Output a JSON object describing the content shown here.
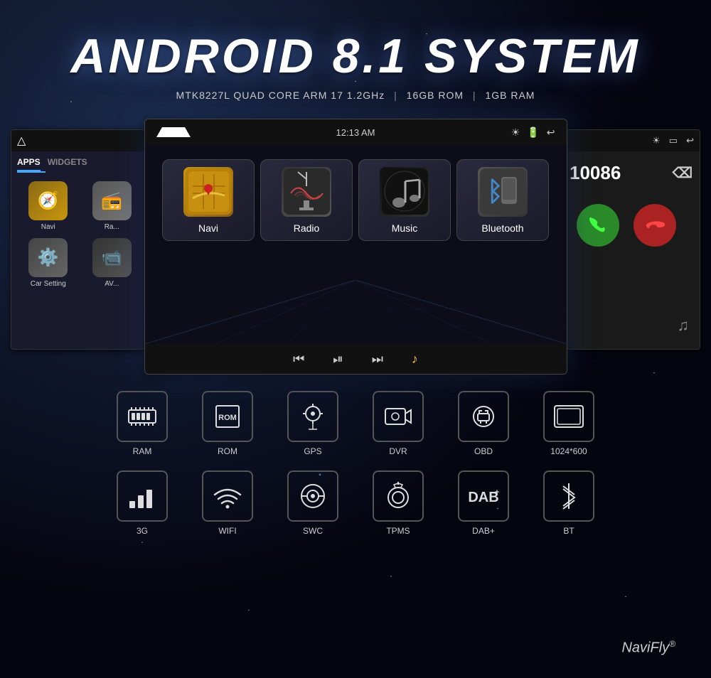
{
  "header": {
    "main_title": "ANDROID 8.1 SYSTEM",
    "sub_title": "MTK8227L QUAD CORE ARM 17 1.2GHz",
    "spec_rom": "16GB ROM",
    "spec_ram": "1GB RAM"
  },
  "left_screen": {
    "tabs": [
      {
        "label": "APPS",
        "active": true
      },
      {
        "label": "WIDGETS",
        "active": false
      }
    ],
    "apps": [
      {
        "label": "Navi",
        "icon": "🧭"
      },
      {
        "label": "Ra...",
        "icon": "📻"
      },
      {
        "label": "Car Setting",
        "icon": "⚙️"
      },
      {
        "label": "AV...",
        "icon": "📹"
      }
    ]
  },
  "center_screen": {
    "time": "12:13 AM",
    "apps": [
      {
        "label": "Navi",
        "icon": "navi"
      },
      {
        "label": "Radio",
        "icon": "radio"
      },
      {
        "label": "Music",
        "icon": "music"
      },
      {
        "label": "Bluetooth",
        "icon": "bluetooth"
      }
    ],
    "bottom_controls": [
      {
        "label": "prev",
        "symbol": "⏮"
      },
      {
        "label": "play-pause",
        "symbol": "⏯"
      },
      {
        "label": "next",
        "symbol": "⏭"
      },
      {
        "label": "music-note",
        "symbol": "♪",
        "active": true
      }
    ]
  },
  "right_screen": {
    "phone_number": "10086",
    "accept_label": "📞",
    "decline_label": "📞"
  },
  "features_row1": [
    {
      "label": "RAM",
      "icon": "ram"
    },
    {
      "label": "ROM",
      "icon": "rom"
    },
    {
      "label": "GPS",
      "icon": "gps"
    },
    {
      "label": "DVR",
      "icon": "dvr"
    },
    {
      "label": "OBD",
      "icon": "obd"
    },
    {
      "label": "1024*600",
      "icon": "screen"
    }
  ],
  "features_row2": [
    {
      "label": "3G",
      "icon": "3g"
    },
    {
      "label": "WIFI",
      "icon": "wifi"
    },
    {
      "label": "SWC",
      "icon": "swc"
    },
    {
      "label": "TPMS",
      "icon": "tpms"
    },
    {
      "label": "DAB+",
      "icon": "dab"
    },
    {
      "label": "BT",
      "icon": "bt"
    }
  ],
  "brand": {
    "name": "NaviFly",
    "symbol": "®"
  }
}
